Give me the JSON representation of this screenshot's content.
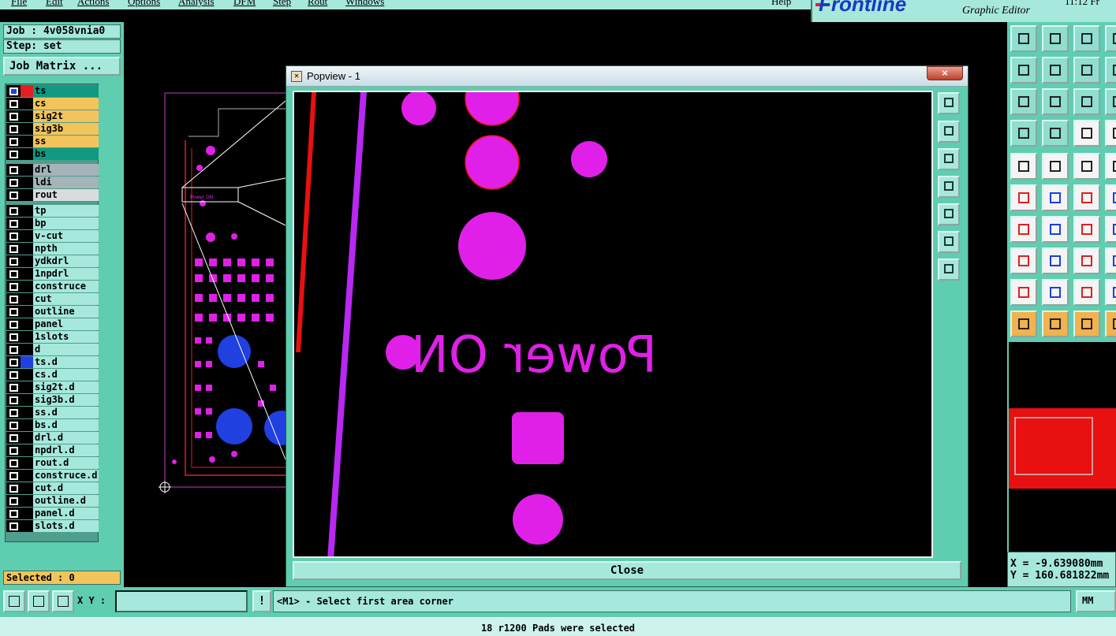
{
  "menubar": {
    "items": [
      "File",
      "Edit",
      "Actions",
      "Options",
      "Analysis",
      "DFM",
      "Step",
      "Rout",
      "Windows"
    ],
    "help": "Help"
  },
  "brand": {
    "logo": "Frontline",
    "subtitle": "Graphic Editor",
    "time": "11:12 Fr"
  },
  "left_panel": {
    "job": "Job : 4v058vnia0",
    "step": "Step: set",
    "job_matrix_button": "Job Matrix ...",
    "layers": [
      {
        "name": "ts",
        "color": "#109a80",
        "swatch": "#e02020",
        "active": true
      },
      {
        "name": "cs",
        "color": "#f2c45c"
      },
      {
        "name": "sig2t",
        "color": "#f2c45c"
      },
      {
        "name": "sig3b",
        "color": "#f2c45c"
      },
      {
        "name": "ss",
        "color": "#f2c45c"
      },
      {
        "name": "bs",
        "color": "#109a80"
      },
      {
        "name": "drl",
        "color": "#a4b4b8"
      },
      {
        "name": "ldi",
        "color": "#a4b4b8"
      },
      {
        "name": "rout",
        "color": "#d8dcdc"
      },
      {
        "name": "tp",
        "color": "#a6e8dc"
      },
      {
        "name": "bp",
        "color": "#a6e8dc"
      },
      {
        "name": "v-cut",
        "color": "#a6e8dc"
      },
      {
        "name": "npth",
        "color": "#a6e8dc"
      },
      {
        "name": "ydkdrl",
        "color": "#a6e8dc"
      },
      {
        "name": "1npdrl",
        "color": "#a6e8dc"
      },
      {
        "name": "construce",
        "color": "#a6e8dc"
      },
      {
        "name": "cut",
        "color": "#a6e8dc"
      },
      {
        "name": "outline",
        "color": "#a6e8dc"
      },
      {
        "name": "panel",
        "color": "#a6e8dc"
      },
      {
        "name": "1slots",
        "color": "#a6e8dc"
      },
      {
        "name": "d",
        "color": "#a6e8dc"
      },
      {
        "name": "ts.d",
        "color": "#a6e8dc",
        "swatch": "#2040e0"
      },
      {
        "name": "cs.d",
        "color": "#a6e8dc"
      },
      {
        "name": "sig2t.d",
        "color": "#a6e8dc"
      },
      {
        "name": "sig3b.d",
        "color": "#a6e8dc"
      },
      {
        "name": "ss.d",
        "color": "#a6e8dc"
      },
      {
        "name": "bs.d",
        "color": "#a6e8dc"
      },
      {
        "name": "drl.d",
        "color": "#a6e8dc"
      },
      {
        "name": "npdrl.d",
        "color": "#a6e8dc"
      },
      {
        "name": "rout.d",
        "color": "#a6e8dc"
      },
      {
        "name": "construce.d",
        "color": "#a6e8dc"
      },
      {
        "name": "cut.d",
        "color": "#a6e8dc"
      },
      {
        "name": "outline.d",
        "color": "#a6e8dc"
      },
      {
        "name": "panel.d",
        "color": "#a6e8dc"
      },
      {
        "name": "slots.d",
        "color": "#a6e8dc"
      }
    ],
    "selected": "Selected : 0"
  },
  "popview": {
    "title": "Popview - 1",
    "close_x": "×",
    "silkscreen_text": "Power ON",
    "close_button": "Close"
  },
  "canvas": {
    "board_label": "Power ON"
  },
  "coords": {
    "x": "X = -9.639080mm",
    "y": "Y = 160.681822mm"
  },
  "bottom": {
    "xy_label": "X Y :",
    "xy_value": "",
    "warn": "!",
    "prompt": "<M1> - Select first area corner",
    "units": "MM"
  },
  "status": "18 r1200 Pads were selected",
  "colors": {
    "panel": "#5fcdb0",
    "panel_light": "#a6e8dc",
    "magenta": "#e020e8",
    "blue_pad": "#2040e0",
    "red": "#e81010"
  }
}
